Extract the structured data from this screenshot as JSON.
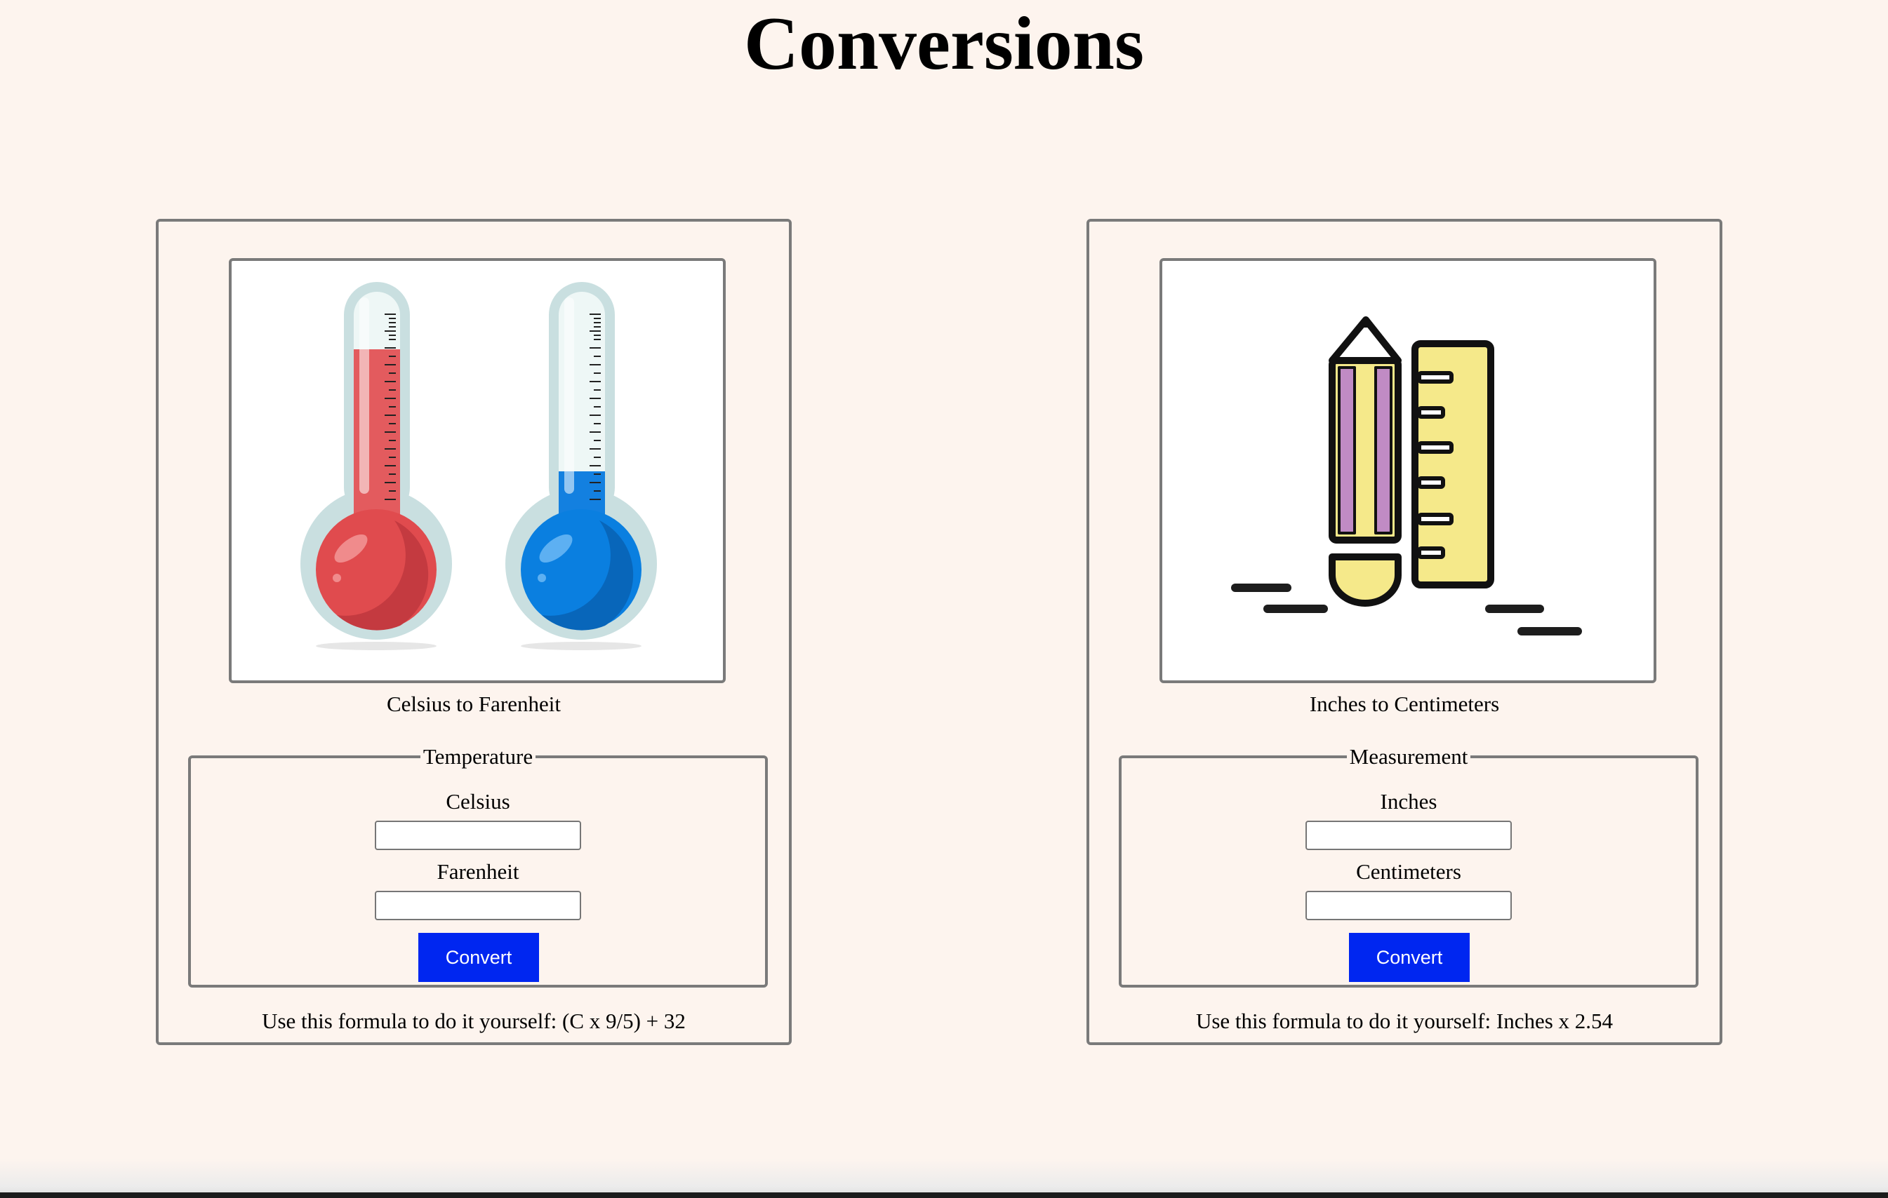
{
  "page": {
    "title": "Conversions"
  },
  "temperature_card": {
    "image_alt": "thermometers",
    "caption": "Celsius to Farenheit",
    "legend": "Temperature",
    "field1_label": "Celsius",
    "field1_value": "",
    "field2_label": "Farenheit",
    "field2_value": "",
    "button_label": "Convert",
    "formula": "Use this formula to do it yourself: (C x 9/5) + 32"
  },
  "measurement_card": {
    "image_alt": "pencil and ruler",
    "caption": "Inches to Centimeters",
    "legend": "Measurement",
    "field1_label": "Inches",
    "field1_value": "",
    "field2_label": "Centimeters",
    "field2_value": "",
    "button_label": "Convert",
    "formula": "Use this formula to do it yourself: Inches x 2.54"
  },
  "colors": {
    "background": "#fdf4ee",
    "button": "#0026f0",
    "border": "#7a7a7a",
    "hot_thermometer": "#e04b4e",
    "cold_thermometer": "#0a7fe0",
    "ruler_yellow": "#f5e98a",
    "pencil_purple": "#c08bc4"
  }
}
